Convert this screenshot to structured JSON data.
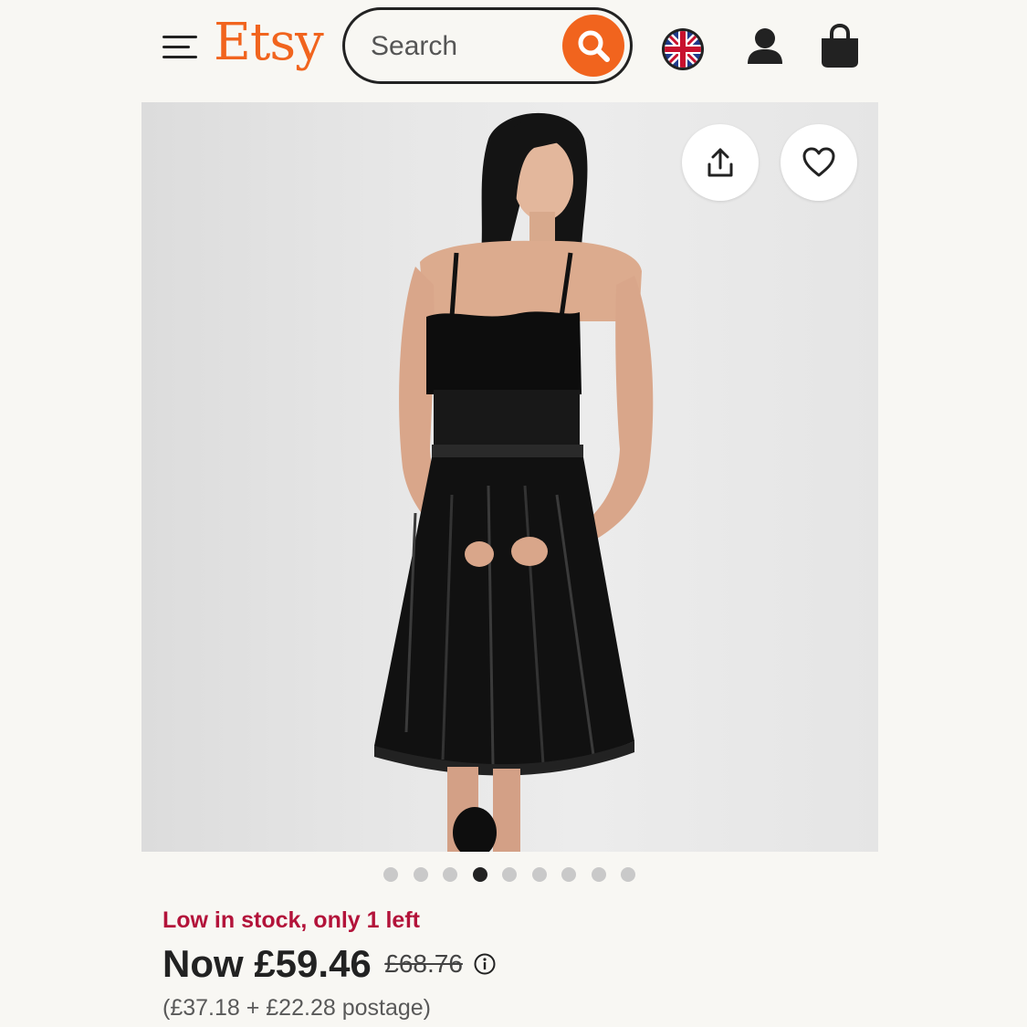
{
  "header": {
    "logo": "Etsy",
    "search_placeholder": "Search",
    "menu_icon": "hamburger-menu-icon",
    "search_icon": "search-icon",
    "region_icon": "uk-flag-icon",
    "account_icon": "account-icon",
    "cart_icon": "shopping-bag-icon",
    "brand_color": "#f1641e"
  },
  "gallery": {
    "image_count": 9,
    "active_index": 3,
    "share_icon": "share-icon",
    "favorite_icon": "heart-icon"
  },
  "product": {
    "stock_message": "Low in stock, only 1 left",
    "price_now": "Now £59.46",
    "price_original": "£68.76",
    "price_breakdown": "(£37.18 + £22.28 postage)",
    "info_icon": "info-icon",
    "stock_color": "#b3133a"
  }
}
